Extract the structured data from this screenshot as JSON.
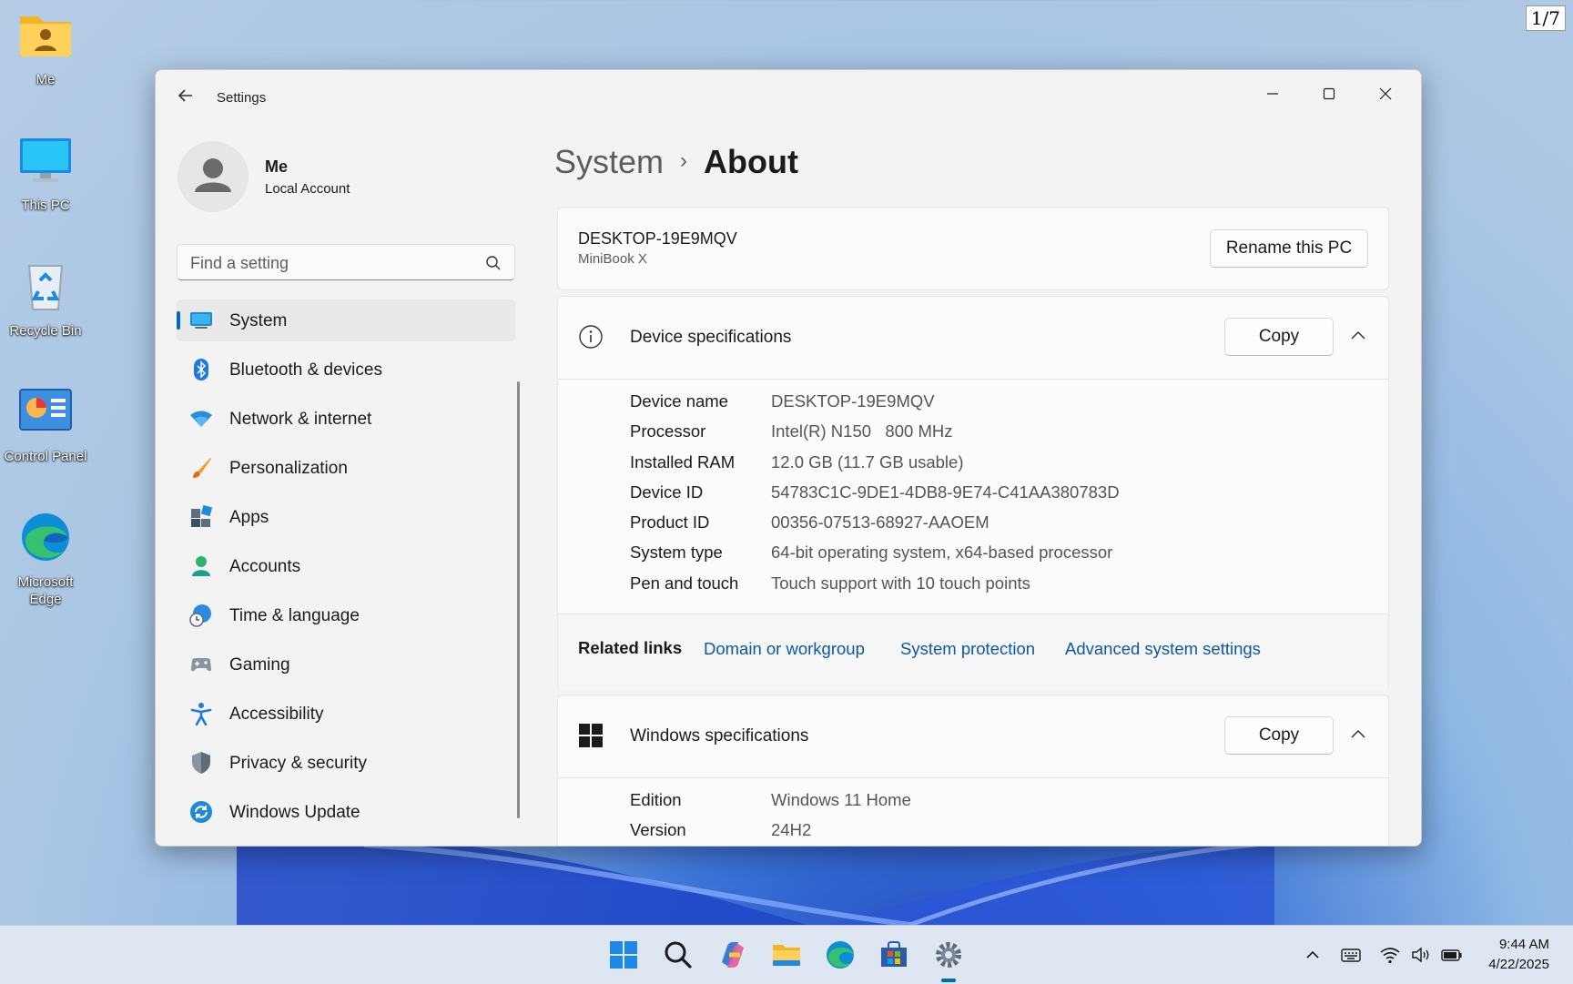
{
  "desktop": {
    "page_counter": "1/7",
    "icons": [
      {
        "label": "Me",
        "icon": "user-folder-icon"
      },
      {
        "label": "This PC",
        "icon": "monitor-icon"
      },
      {
        "label": "Recycle Bin",
        "icon": "recycle-bin-icon"
      },
      {
        "label": "Control Panel",
        "icon": "control-panel-icon"
      },
      {
        "label": "Microsoft Edge",
        "icon": "edge-icon"
      }
    ]
  },
  "window": {
    "title": "Settings",
    "controls": {
      "minimize": "minimize-icon",
      "maximize": "maximize-icon",
      "close": "close-icon"
    }
  },
  "profile": {
    "name": "Me",
    "account_type": "Local Account"
  },
  "search": {
    "placeholder": "Find a setting"
  },
  "sidebar": {
    "items": [
      {
        "label": "System",
        "icon": "system-icon",
        "active": true
      },
      {
        "label": "Bluetooth & devices",
        "icon": "bluetooth-icon"
      },
      {
        "label": "Network & internet",
        "icon": "wifi-icon"
      },
      {
        "label": "Personalization",
        "icon": "brush-icon"
      },
      {
        "label": "Apps",
        "icon": "apps-icon"
      },
      {
        "label": "Accounts",
        "icon": "accounts-icon"
      },
      {
        "label": "Time & language",
        "icon": "globe-clock-icon"
      },
      {
        "label": "Gaming",
        "icon": "gamepad-icon"
      },
      {
        "label": "Accessibility",
        "icon": "accessibility-icon"
      },
      {
        "label": "Privacy & security",
        "icon": "shield-icon"
      },
      {
        "label": "Windows Update",
        "icon": "update-icon"
      }
    ]
  },
  "breadcrumb": {
    "parent": "System",
    "separator": "›",
    "current": "About"
  },
  "pc": {
    "name": "DESKTOP-19E9MQV",
    "model": "MiniBook X",
    "rename_label": "Rename this PC"
  },
  "device_specs": {
    "title": "Device specifications",
    "copy_label": "Copy",
    "rows": [
      {
        "label": "Device name",
        "value": "DESKTOP-19E9MQV"
      },
      {
        "label": "Processor",
        "value": "Intel(R) N150   800 MHz"
      },
      {
        "label": "Installed RAM",
        "value": "12.0 GB (11.7 GB usable)"
      },
      {
        "label": "Device ID",
        "value": "54783C1C-9DE1-4DB8-9E74-C41AA380783D"
      },
      {
        "label": "Product ID",
        "value": "00356-07513-68927-AAOEM"
      },
      {
        "label": "System type",
        "value": "64-bit operating system, x64-based processor"
      },
      {
        "label": "Pen and touch",
        "value": "Touch support with 10 touch points"
      }
    ]
  },
  "related_links": {
    "title": "Related links",
    "links": [
      "Domain or workgroup",
      "System protection",
      "Advanced system settings"
    ]
  },
  "windows_specs": {
    "title": "Windows specifications",
    "copy_label": "Copy",
    "rows": [
      {
        "label": "Edition",
        "value": "Windows 11 Home"
      },
      {
        "label": "Version",
        "value": "24H2"
      }
    ]
  },
  "taskbar": {
    "apps": [
      "start-icon",
      "search-icon",
      "copilot-icon",
      "file-explorer-icon",
      "edge-icon",
      "store-icon",
      "settings-icon"
    ],
    "tray": [
      "show-hidden-icons-icon",
      "keyboard-icon",
      "wifi-icon",
      "volume-icon",
      "battery-icon"
    ],
    "time": "9:44 AM",
    "date": "4/22/2025"
  },
  "colors": {
    "accent": "#0067c0",
    "link": "#0a59a5"
  }
}
